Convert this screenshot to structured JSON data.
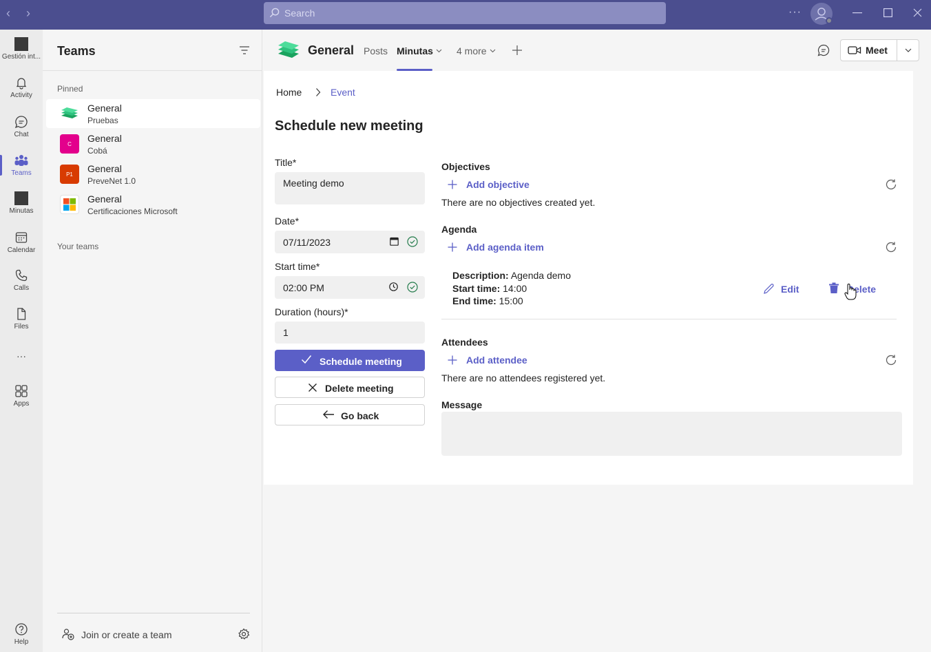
{
  "titlebar": {
    "back": "‹",
    "forward": "›",
    "search_placeholder": "Search",
    "more": "···"
  },
  "rail": {
    "items": [
      {
        "label": "Gestión int..."
      },
      {
        "label": "Activity"
      },
      {
        "label": "Chat"
      },
      {
        "label": "Teams"
      },
      {
        "label": "Minutas"
      },
      {
        "label": "Calendar"
      },
      {
        "label": "Calls"
      },
      {
        "label": "Files"
      },
      {
        "label": "···"
      },
      {
        "label": "Apps"
      },
      {
        "label": "Help"
      }
    ]
  },
  "teams_panel": {
    "title": "Teams",
    "pinned_label": "Pinned",
    "your_teams_label": "Your teams",
    "teams": [
      {
        "name": "General",
        "sub": "Pruebas",
        "logo_text": ""
      },
      {
        "name": "General",
        "sub": "Cobá",
        "logo_text": "C"
      },
      {
        "name": "General",
        "sub": "PreveNet 1.0",
        "logo_text": "P1"
      },
      {
        "name": "General",
        "sub": "Certificaciones Microsoft",
        "logo_text": ""
      }
    ],
    "join_label": "Join or create a team"
  },
  "channel": {
    "name": "General",
    "tabs": [
      "Posts",
      "Minutas",
      "4 more"
    ],
    "meet_label": "Meet"
  },
  "breadcrumb": {
    "home": "Home",
    "current": "Event"
  },
  "form": {
    "page_title": "Schedule new meeting",
    "title_label": "Title*",
    "title_value": "Meeting  demo",
    "date_label": "Date*",
    "date_value": "07/11/2023",
    "start_label": "Start time*",
    "start_value": "02:00 PM",
    "duration_label": "Duration (hours)*",
    "duration_value": "1",
    "schedule_btn": "Schedule meeting",
    "delete_btn": "Delete meeting",
    "back_btn": "Go back"
  },
  "objectives": {
    "title": "Objectives",
    "add": "Add objective",
    "empty": "There are no objectives created yet."
  },
  "agenda": {
    "title": "Agenda",
    "add": "Add agenda item",
    "item": {
      "desc_label": "Description:",
      "desc_value": "Agenda demo",
      "start_label": "Start time:",
      "start_value": "14:00",
      "end_label": "End time:",
      "end_value": "15:00"
    },
    "edit": "Edit",
    "delete": "Delete"
  },
  "attendees": {
    "title": "Attendees",
    "add": "Add attendee",
    "empty": "There are no attendees registered yet."
  },
  "message": {
    "title": "Message"
  },
  "colors": {
    "brand": "#5b5fc7",
    "titlebar": "#4b4e8f",
    "pruebas_logo": "#2ec27e",
    "coba_logo": "#e3008c",
    "prevenet_logo": "#d83b01"
  }
}
